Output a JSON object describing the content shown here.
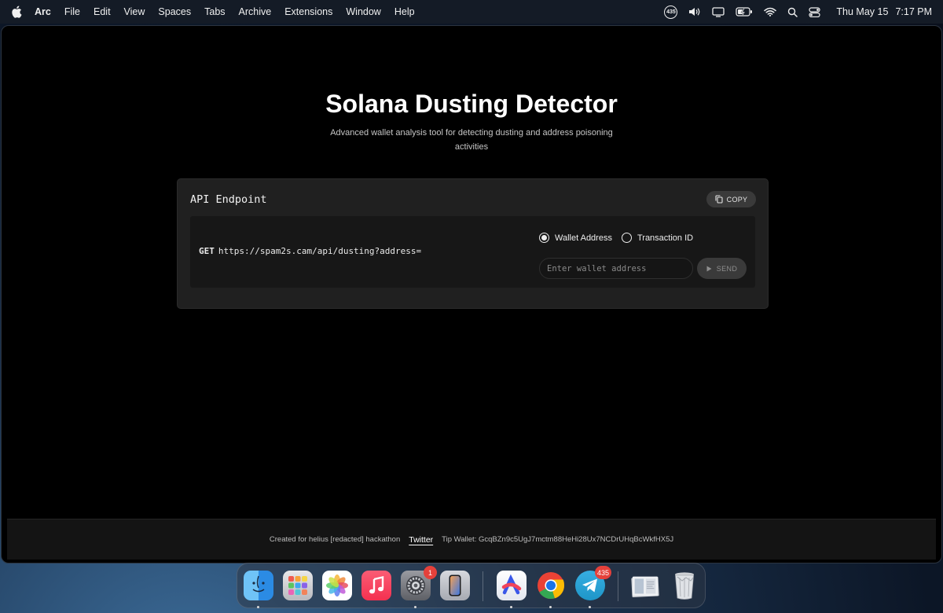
{
  "menubar": {
    "app_name": "Arc",
    "menus": [
      "File",
      "Edit",
      "View",
      "Spaces",
      "Tabs",
      "Archive",
      "Extensions",
      "Window",
      "Help"
    ],
    "status_badge": "435",
    "date": "Thu May 15",
    "time": "7:17 PM"
  },
  "page": {
    "title": "Solana Dusting Detector",
    "subtitle": "Advanced wallet analysis tool for detecting dusting and address poisoning activities"
  },
  "api_card": {
    "title": "API Endpoint",
    "copy_label": "COPY",
    "method": "GET",
    "url": "https://spam2s.cam/api/dusting?address=",
    "radio_options": [
      {
        "label": "Wallet Address",
        "selected": true
      },
      {
        "label": "Transaction ID",
        "selected": false
      }
    ],
    "input_placeholder": "Enter wallet address",
    "input_value": "",
    "send_label": "SEND"
  },
  "footer": {
    "created_text": "Created for helius [redacted] hackathon",
    "twitter_label": "Twitter",
    "tip_wallet": "Tip Wallet: GcqBZn9c5UgJ7mctm88HeHi28Ux7NCDrUHqBcWkfHX5J"
  },
  "dock": {
    "apps": [
      {
        "name": "finder",
        "running": true
      },
      {
        "name": "launchpad",
        "running": false
      },
      {
        "name": "photos",
        "running": false
      },
      {
        "name": "music",
        "running": false
      },
      {
        "name": "system-settings",
        "running": true,
        "badge": "1"
      },
      {
        "name": "iphone-mirroring",
        "running": false
      },
      {
        "name": "arc-browser",
        "running": true
      },
      {
        "name": "chrome",
        "running": true
      },
      {
        "name": "telegram",
        "running": true,
        "badge": "435"
      },
      {
        "name": "downloads-stack",
        "running": false
      },
      {
        "name": "trash",
        "running": false
      }
    ]
  },
  "colors": {
    "page_bg": "#000000",
    "card_bg": "#202020",
    "endpoint_bg": "#171717",
    "button_bg": "#3a3a3a",
    "badge_red": "#e5413b"
  }
}
